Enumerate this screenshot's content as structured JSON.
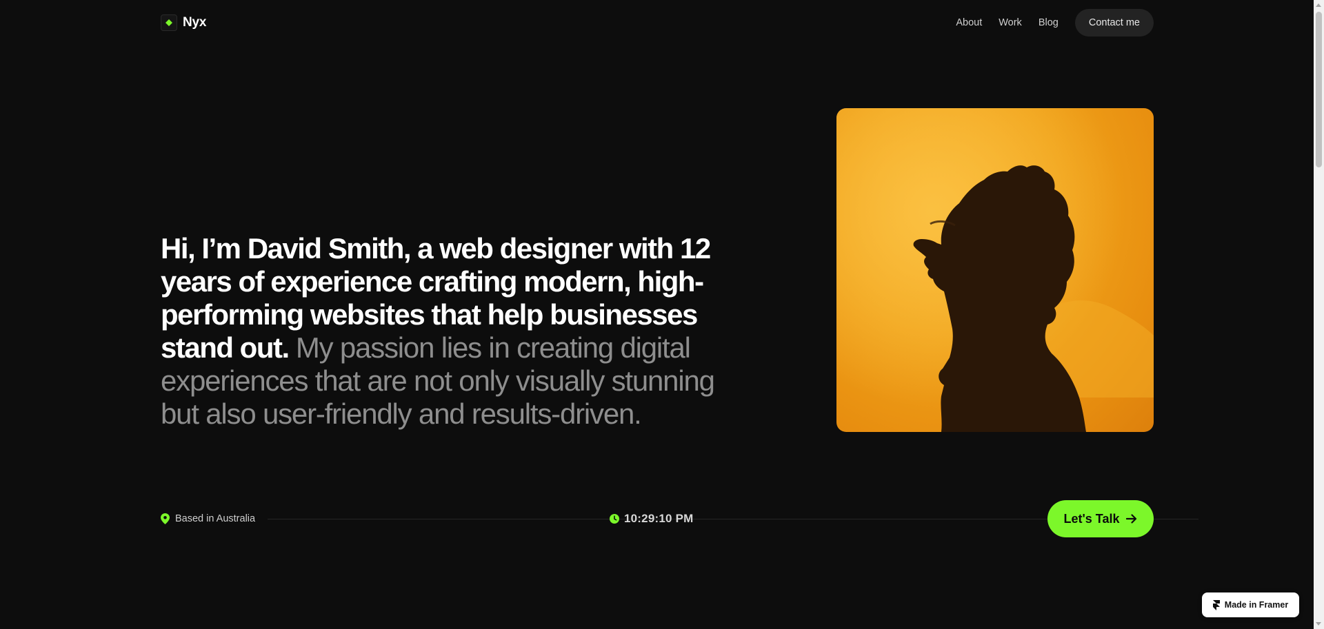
{
  "colors": {
    "background": "#0d0d0d",
    "accent": "#7cf72a",
    "portrait_bg": "#f0a21a",
    "muted_text": "#8e8e8e"
  },
  "nav": {
    "brand_icon": "diamond-icon",
    "brand_name": "Nyx",
    "links": [
      "About",
      "Work",
      "Blog"
    ],
    "contact_label": "Contact me"
  },
  "hero": {
    "headline_primary": "Hi, I’m David Smith, a web designer with 12 years of experience crafting modern, high-performing websites that help businesses stand out.",
    "headline_secondary": "My passion lies in creating digital experiences that are not only visually stunning but also user-friendly and results-driven."
  },
  "portrait": {
    "icon": "silhouette-portrait"
  },
  "strip": {
    "location_icon": "location-pin-icon",
    "location_text": "Based in Australia",
    "clock_icon": "clock-icon",
    "time_text": "10:29:10 PM",
    "cta_label": "Let's Talk",
    "cta_icon": "arrow-right-icon"
  },
  "badge": {
    "icon": "framer-logo-icon",
    "label": "Made in Framer"
  }
}
